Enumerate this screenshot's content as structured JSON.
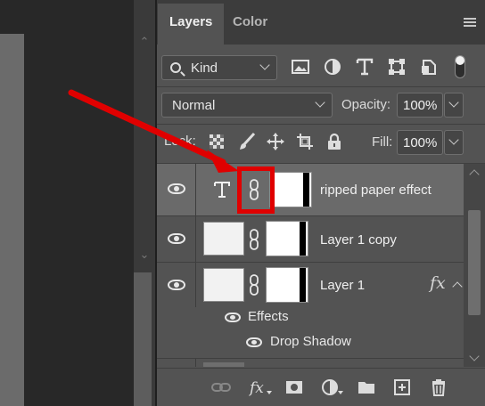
{
  "panel": {
    "tabs": [
      {
        "label": "Layers"
      },
      {
        "label": "Color"
      }
    ],
    "menu_icon": "hamburger-icon"
  },
  "filter": {
    "kind_label": "Kind",
    "icons": [
      "pixel-layer-filter-icon",
      "adjustment-layer-filter-icon",
      "type-layer-filter-icon",
      "shape-layer-filter-icon",
      "smart-object-filter-icon",
      "filter-toggle-icon"
    ]
  },
  "blend": {
    "mode": "Normal",
    "opacity_label": "Opacity:",
    "opacity_value": "100%"
  },
  "lock": {
    "label": "Lock:",
    "fill_label": "Fill:",
    "fill_value": "100%",
    "icons": [
      "lock-transparent-pixels-icon",
      "lock-image-pixels-icon",
      "lock-position-icon",
      "lock-artboard-icon",
      "lock-all-icon"
    ]
  },
  "layers": [
    {
      "name": "ripped paper effect",
      "type": "text",
      "selected": true
    },
    {
      "name": "Layer 1 copy",
      "type": "pixel",
      "selected": false
    },
    {
      "name": "Layer 1",
      "type": "pixel",
      "selected": false,
      "fx": "fx",
      "effects_label": "Effects",
      "effects": [
        "Drop Shadow"
      ]
    }
  ],
  "bottom_icons": [
    "link-layers-icon",
    "add-layer-style-icon",
    "add-mask-icon",
    "new-adjustment-layer-icon",
    "new-group-icon",
    "new-layer-icon",
    "delete-layer-icon"
  ],
  "colors": {
    "highlight": "#e00000",
    "panel_bg": "#535353",
    "selected_row": "#6a6a6a"
  }
}
